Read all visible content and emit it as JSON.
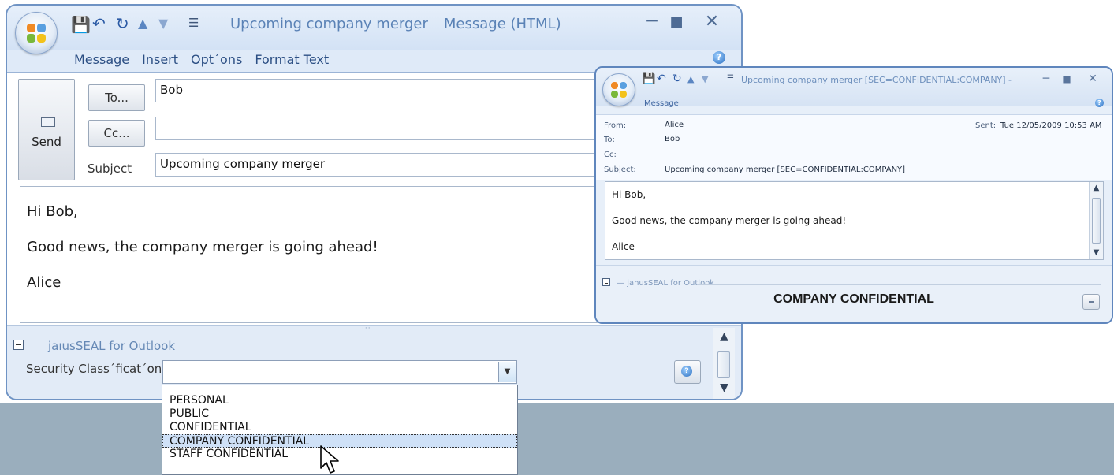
{
  "compose": {
    "title": "Upcoming company merger",
    "title_suffix": "Message (HTML)",
    "ribbon_tabs": [
      "Message",
      "Insert",
      "Opt´ons",
      "Format Text"
    ],
    "send_label": "Send",
    "to_button": "To...",
    "cc_button": "Cc...",
    "subject_label": "Subject",
    "to_value": "Bob",
    "cc_value": "",
    "subject_value": "Upcoming company merger",
    "body_lines": [
      "Hi Bob,",
      "Good news, the company merger is going ahead!",
      "Alice"
    ],
    "addin_label": "jaıusSEAL for Outlook",
    "security_label": "Security Class´ficat´on",
    "security_value": "",
    "dropdown_options": [
      "PERSONAL",
      "PUBLIC",
      "CONFIDENTIAL",
      "COMPANY CONFIDENTIAL",
      "STAFF CONFIDENTIAL"
    ],
    "dropdown_selected": "COMPANY CONFIDENTIAL"
  },
  "received": {
    "title": "Upcoming company merger [SEC=CONFIDENTIAL:COMPANY] -",
    "ribbon_tab": "Message",
    "from_label": "From:",
    "from_value": "Alice",
    "to_label": "To:",
    "to_value": "Bob",
    "cc_label": "Cc:",
    "cc_value": "",
    "subject_label": "Subject:",
    "subject_value": "Upcoming company merger [SEC=CONFIDENTIAL:COMPANY]",
    "sent_label": "Sent:",
    "sent_value": "Tue 12/05/2009 10:53 AM",
    "body_lines": [
      "Hi Bob,",
      "Good news, the company merger is going ahead!",
      "Alice"
    ],
    "addin_label": "janusSEAL for Outlook",
    "classification": "COMPANY CONFIDENTIAL"
  },
  "icons": [
    "office-orb-icon",
    "save-icon",
    "undo-icon",
    "redo-icon",
    "up-arrow-icon",
    "down-arrow-icon",
    "qat-customize-icon",
    "minimize-icon",
    "maximize-icon",
    "close-icon",
    "help-icon",
    "envelope-icon",
    "collapse-icon",
    "dropdown-arrow-icon",
    "mouse-cursor-icon"
  ],
  "colors": {
    "accent": "#2c4f84",
    "frame": "#6f93c4",
    "selection": "#cfe1f7",
    "backdrop": "#9aaebd"
  }
}
